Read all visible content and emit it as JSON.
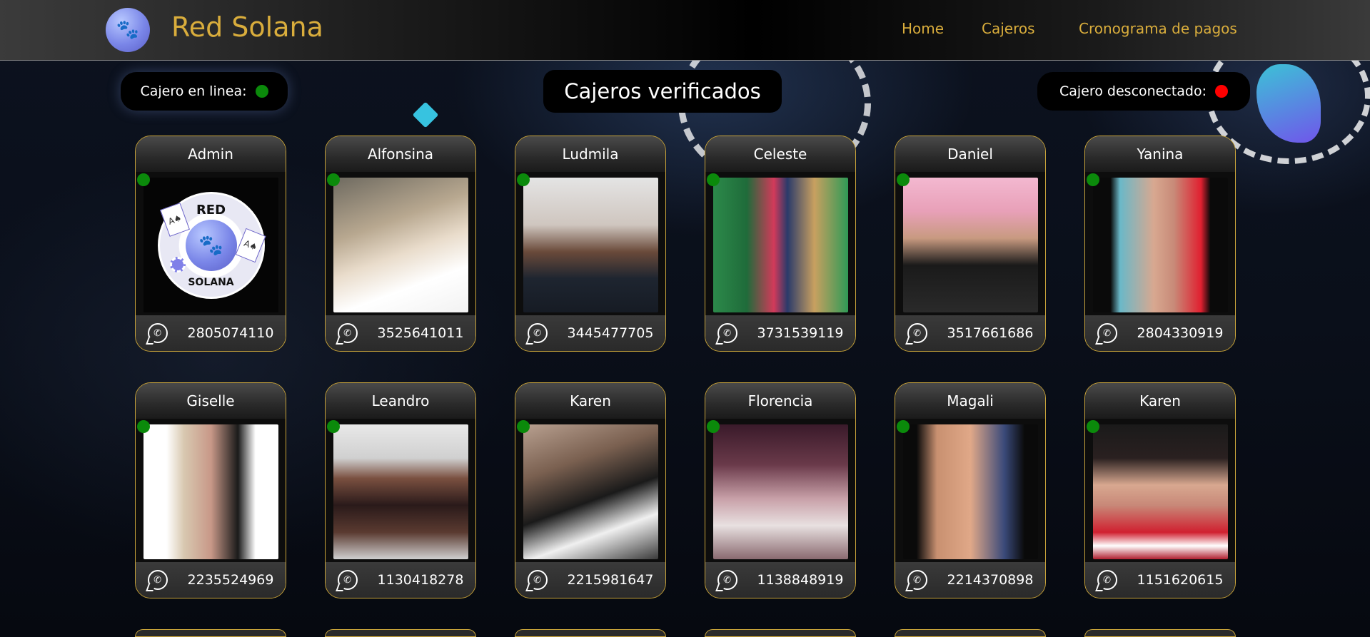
{
  "app": {
    "brand": "Red Solana",
    "logo_icon": "panther-icon"
  },
  "nav": {
    "items": [
      "Home",
      "Cajeros",
      "Cronograma de pagos"
    ]
  },
  "legend": {
    "online_label": "Cajero en linea:",
    "online_color": "#0b8a0b",
    "offline_label": "Cajero desconectado:",
    "offline_color": "#ff0000"
  },
  "page_title": "Cajeros verificados",
  "admin_logo": {
    "line1": "RED",
    "line2": "SOLANA"
  },
  "cashiers": [
    {
      "name": "Admin",
      "phone": "2805074110",
      "status": "online"
    },
    {
      "name": "Alfonsina",
      "phone": "3525641011",
      "status": "online"
    },
    {
      "name": "Ludmila",
      "phone": "3445477705",
      "status": "online"
    },
    {
      "name": "Celeste",
      "phone": "3731539119",
      "status": "online"
    },
    {
      "name": "Daniel",
      "phone": "3517661686",
      "status": "online"
    },
    {
      "name": "Yanina",
      "phone": "2804330919",
      "status": "online"
    },
    {
      "name": "Giselle",
      "phone": "2235524969",
      "status": "online"
    },
    {
      "name": "Leandro",
      "phone": "1130418278",
      "status": "online"
    },
    {
      "name": "Karen",
      "phone": "2215981647",
      "status": "online"
    },
    {
      "name": "Florencia",
      "phone": "1138848919",
      "status": "online"
    },
    {
      "name": "Magali",
      "phone": "2214370898",
      "status": "online"
    },
    {
      "name": "Karen",
      "phone": "1151620615",
      "status": "online"
    }
  ],
  "colors": {
    "accent_gold": "#d9ad3c",
    "card_border": "#c9a43a",
    "online": "#0b8a0b",
    "offline": "#ff0000"
  }
}
